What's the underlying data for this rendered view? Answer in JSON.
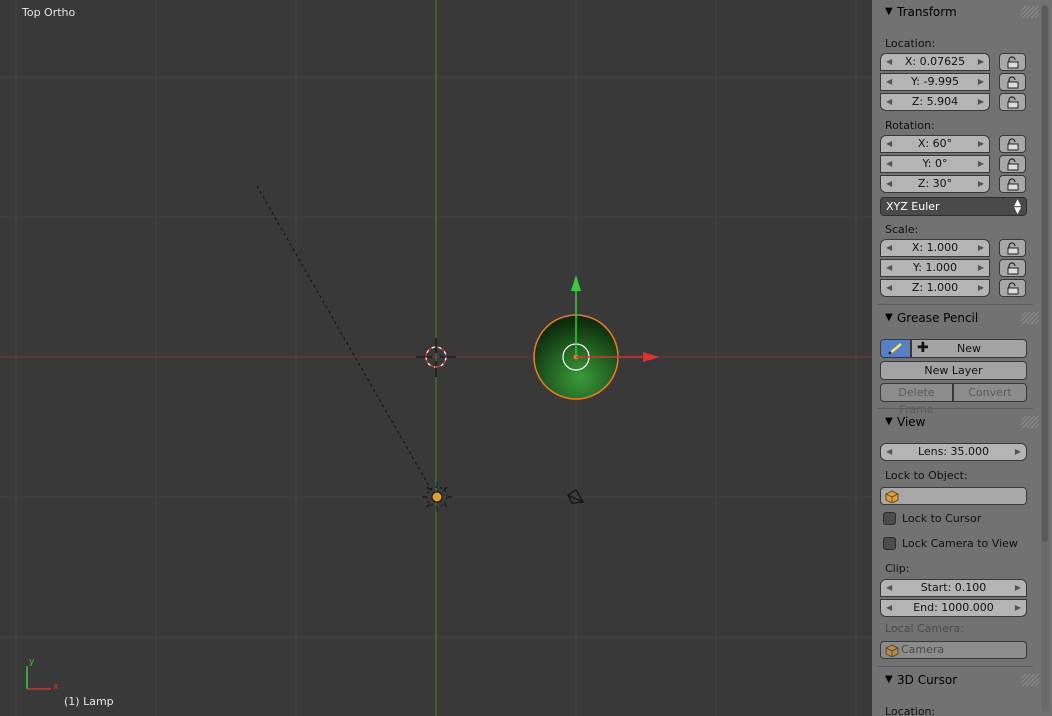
{
  "viewport": {
    "view_label": "Top Ortho",
    "object_label": "(1) Lamp",
    "axis_y": "y",
    "axis_x": "x"
  },
  "panels": {
    "transform": {
      "title": "Transform",
      "location_label": "Location:",
      "location": [
        "X: 0.07625",
        "Y: -9.995",
        "Z: 5.904"
      ],
      "rotation_label": "Rotation:",
      "rotation": [
        "X: 60°",
        "Y: 0°",
        "Z: 30°"
      ],
      "rotation_mode": "XYZ Euler",
      "scale_label": "Scale:",
      "scale": [
        "X: 1.000",
        "Y: 1.000",
        "Z: 1.000"
      ]
    },
    "grease_pencil": {
      "title": "Grease Pencil",
      "new_label": "New",
      "new_layer_label": "New Layer",
      "delete_frame_label": "Delete Frame",
      "convert_label": "Convert"
    },
    "view": {
      "title": "View",
      "lens": "Lens: 35.000",
      "lock_to_object_label": "Lock to Object:",
      "lock_to_cursor_label": "Lock to Cursor",
      "lock_camera_label": "Lock Camera to View",
      "clip_label": "Clip:",
      "clip_start": "Start: 0.100",
      "clip_end": "End: 1000.000",
      "local_camera_label": "Local Camera:",
      "local_camera_value": "Camera"
    },
    "cursor": {
      "title": "3D Cursor",
      "location_label": "Location:"
    }
  },
  "colors": {
    "x_axis": "#c83c3c",
    "y_axis": "#3cb43c",
    "selection": "#f07c1c",
    "accent": "#5680c2"
  },
  "icons": {
    "panel_collapse": "triangle-down-icon",
    "lock": "padlock-icon",
    "pencil": "pencil-icon",
    "add": "plus-icon",
    "object": "cube-icon"
  }
}
